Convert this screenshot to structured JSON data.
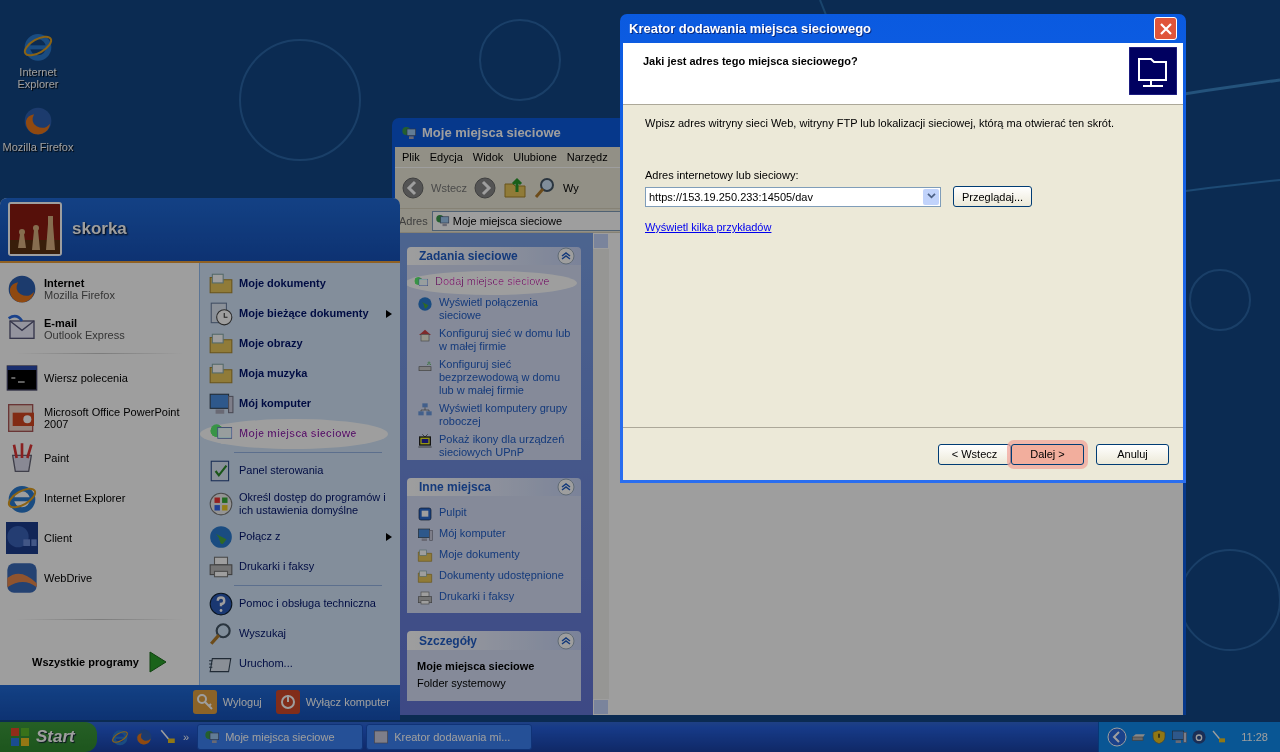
{
  "desktop_icons": [
    {
      "label": "Internet Explorer"
    },
    {
      "label": "Mozilla Firefox"
    }
  ],
  "start_menu": {
    "user": "skorka",
    "pinned": [
      {
        "title": "Internet",
        "subtitle": "Mozilla Firefox"
      },
      {
        "title": "E-mail",
        "subtitle": "Outlook Express"
      }
    ],
    "recent": [
      {
        "label": "Wiersz polecenia"
      },
      {
        "label": "Microsoft Office PowerPoint 2007"
      },
      {
        "label": "Paint"
      },
      {
        "label": "Internet Explorer"
      },
      {
        "label": "Client"
      },
      {
        "label": "WebDrive"
      }
    ],
    "all_programs": "Wszystkie programy",
    "place_groups": [
      {
        "items": [
          {
            "label": "Moje dokumenty",
            "submenu": false,
            "highlighted": false
          },
          {
            "label": "Moje bieżące dokumenty",
            "submenu": true,
            "highlighted": false
          },
          {
            "label": "Moje obrazy",
            "submenu": false,
            "highlighted": false
          },
          {
            "label": "Moja muzyka",
            "submenu": false,
            "highlighted": false
          },
          {
            "label": "Mój komputer",
            "submenu": false,
            "highlighted": false
          },
          {
            "label": "Moje miejsca sieciowe",
            "submenu": false,
            "highlighted": true
          }
        ]
      },
      {
        "items": [
          {
            "label": "Panel sterowania",
            "submenu": false,
            "highlighted": false
          },
          {
            "label": "Określ dostęp do programów i ich ustawienia domyślne",
            "submenu": false,
            "highlighted": false
          },
          {
            "label": "Połącz z",
            "submenu": true,
            "highlighted": false
          },
          {
            "label": "Drukarki i faksy",
            "submenu": false,
            "highlighted": false
          }
        ]
      },
      {
        "items": [
          {
            "label": "Pomoc i obsługa techniczna",
            "submenu": false,
            "highlighted": false
          },
          {
            "label": "Wyszukaj",
            "submenu": false,
            "highlighted": false
          },
          {
            "label": "Uruchom...",
            "submenu": false,
            "highlighted": false
          }
        ]
      }
    ],
    "logoff": "Wyloguj",
    "shutdown": "Wyłącz komputer"
  },
  "explorer": {
    "title": "Moje miejsca sieciowe",
    "menu": [
      "Plik",
      "Edycja",
      "Widok",
      "Ulubione",
      "Narzędz"
    ],
    "back": "Wstecz",
    "search": "Wy",
    "address_label": "Adres",
    "address": "Moje miejsca sieciowe",
    "panels": [
      {
        "kind": "links",
        "title": "Zadania sieciowe",
        "items": [
          {
            "label": "Dodaj miejsce sieciowe",
            "highlighted": true
          },
          {
            "label": "Wyświetl połączenia sieciowe",
            "highlighted": false
          },
          {
            "label": "Konfiguruj sieć w domu lub w małej firmie",
            "highlighted": false
          },
          {
            "label": "Konfiguruj sieć bezprzewodową w domu lub w małej firmie",
            "highlighted": false
          },
          {
            "label": "Wyświetl komputery grupy roboczej",
            "highlighted": false
          },
          {
            "label": "Pokaż ikony dla urządzeń sieciowych UPnP",
            "highlighted": false
          }
        ]
      },
      {
        "kind": "links",
        "title": "Inne miejsca",
        "items": [
          {
            "label": "Pulpit",
            "highlighted": false
          },
          {
            "label": "Mój komputer",
            "highlighted": false
          },
          {
            "label": "Moje dokumenty",
            "highlighted": false
          },
          {
            "label": "Dokumenty udostępnione",
            "highlighted": false
          },
          {
            "label": "Drukarki i faksy",
            "highlighted": false
          }
        ]
      },
      {
        "kind": "details",
        "title": "Szczegóły",
        "name": "Moje miejsca sieciowe",
        "description": "Folder systemowy"
      }
    ]
  },
  "wizard": {
    "title": "Kreator dodawania miejsca sieciowego",
    "heading": "Jaki jest adres tego miejsca sieciowego?",
    "instruction": "Wpisz adres witryny sieci Web, witryny FTP lub lokalizacji sieciowej, którą ma otwierać ten skrót.",
    "field_label": "Adres internetowy lub sieciowy:",
    "address": "https://153.19.250.233:14505/dav",
    "browse": "Przeglądaj...",
    "examples_link": "Wyświetl kilka przykładów",
    "buttons": [
      {
        "label": "< Wstecz",
        "highlighted": false
      },
      {
        "label": "Dalej >",
        "highlighted": true
      },
      {
        "label": "Anuluj",
        "highlighted": false
      }
    ]
  },
  "taskbar": {
    "start": "Start",
    "chevron": "»",
    "tasks": [
      {
        "label": "Moje miejsca sieciowe"
      },
      {
        "label": "Kreator dodawania mi..."
      }
    ],
    "clock": "11:28"
  }
}
